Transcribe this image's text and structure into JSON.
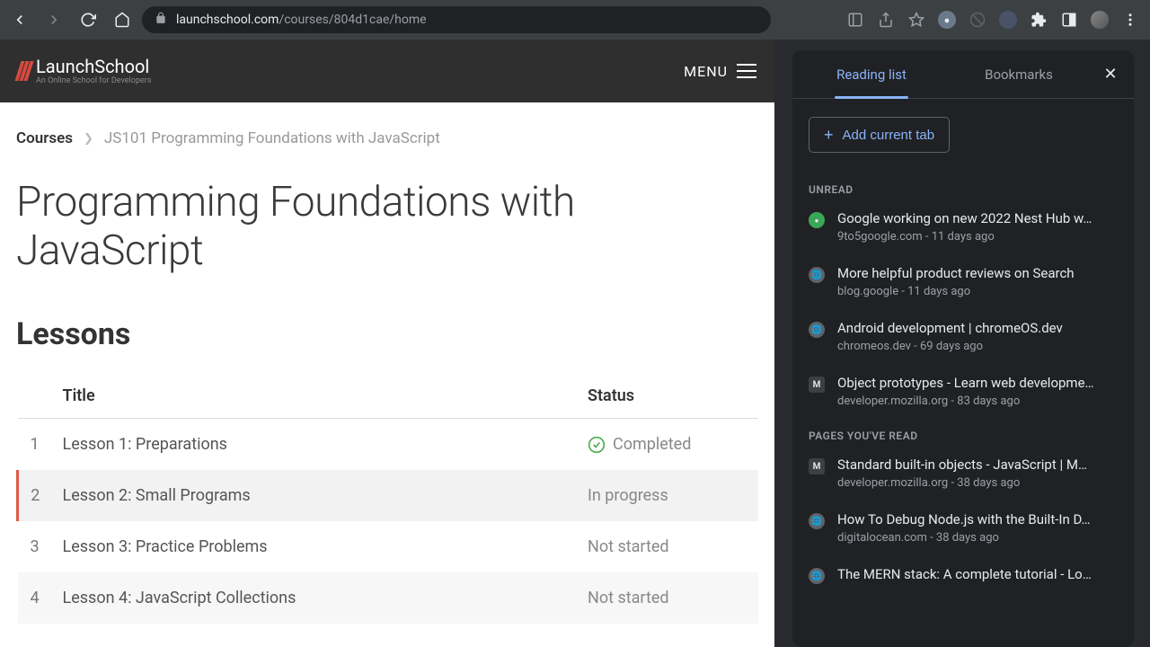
{
  "browser": {
    "url_domain": "launchschool.com",
    "url_path": "/courses/804d1cae/home"
  },
  "header": {
    "logo_title": "LaunchSchool",
    "logo_tag": "An Online School for Developers",
    "menu_label": "MENU"
  },
  "breadcrumb": {
    "root": "Courses",
    "current": "JS101 Programming Foundations with JavaScript"
  },
  "page_title": "Programming Foundations with JavaScript",
  "lessons_heading": "Lessons",
  "table": {
    "col_title": "Title",
    "col_status": "Status",
    "rows": [
      {
        "num": "1",
        "title": "Lesson 1: Preparations",
        "status": "Completed",
        "state": "completed"
      },
      {
        "num": "2",
        "title": "Lesson 2: Small Programs",
        "status": "In progress",
        "state": "active"
      },
      {
        "num": "3",
        "title": "Lesson 3: Practice Problems",
        "status": "Not started",
        "state": ""
      },
      {
        "num": "4",
        "title": "Lesson 4: JavaScript Collections",
        "status": "Not started",
        "state": "odd"
      }
    ]
  },
  "panel": {
    "tab_reading": "Reading list",
    "tab_bookmarks": "Bookmarks",
    "add_btn": "Add current tab",
    "unread_label": "UNREAD",
    "read_label": "PAGES YOU'VE READ",
    "unread": [
      {
        "icon": "●",
        "iconbg": "#3aa757",
        "title": "Google working on new 2022 Nest Hub w…",
        "meta": "9to5google.com - 11 days ago"
      },
      {
        "icon": "🌐",
        "iconbg": "#5f6368",
        "title": "More helpful product reviews on Search",
        "meta": "blog.google - 11 days ago"
      },
      {
        "icon": "🌐",
        "iconbg": "#5f6368",
        "title": "Android development | chromeOS.dev",
        "meta": "chromeos.dev - 69 days ago"
      },
      {
        "icon": "M",
        "iconbg": "#3c4043",
        "title": "Object prototypes - Learn web developme…",
        "meta": "developer.mozilla.org - 83 days ago"
      }
    ],
    "read": [
      {
        "icon": "M",
        "iconbg": "#3c4043",
        "title": "Standard built-in objects - JavaScript | M…",
        "meta": "developer.mozilla.org - 38 days ago"
      },
      {
        "icon": "🌐",
        "iconbg": "#5f6368",
        "title": "How To Debug Node.js with the Built-In D…",
        "meta": "digitalocean.com - 38 days ago"
      },
      {
        "icon": "🌐",
        "iconbg": "#5f6368",
        "title": "The MERN stack: A complete tutorial - Lo…",
        "meta": ""
      }
    ]
  }
}
